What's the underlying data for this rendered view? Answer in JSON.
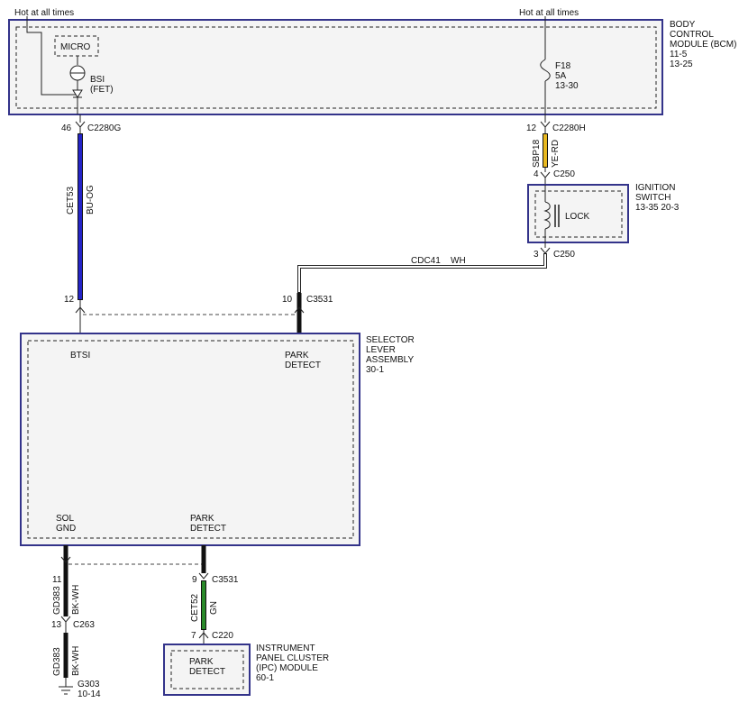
{
  "colors": {
    "bu_og": "#2424c8",
    "ye_rd": "#e8b820",
    "gn": "#2a8a2a",
    "bk_wh": "#222222",
    "wh": "#ffffff",
    "box_border": "#33338a"
  },
  "bcm": {
    "hot_left": "Hot at all times",
    "hot_right": "Hot at all times",
    "title_l1": "BODY",
    "title_l2": "CONTROL",
    "title_l3": "MODULE (BCM)",
    "ref1": "11-5",
    "ref2": "13-25",
    "micro": "MICRO",
    "bsi_l1": "BSI",
    "bsi_l2": "(FET)",
    "fuse_l1": "F18",
    "fuse_l2": "5A",
    "fuse_l3": "13-30"
  },
  "pins": {
    "p46": "46",
    "c2280g": "C2280G",
    "p12h": "12",
    "c2280h": "C2280H",
    "p4": "4",
    "c250a": "C250",
    "p3": "3",
    "c250b": "C250",
    "p12s": "12",
    "p10": "10",
    "c3531a": "C3531",
    "p11": "11",
    "p13": "13",
    "c263": "C263",
    "p9": "9",
    "c3531b": "C3531",
    "p7": "7",
    "c220": "C220",
    "g303": "G303",
    "g303_ref": "10-14"
  },
  "wires": {
    "cet53": "CET53",
    "bu_og": "BU-OG",
    "sbp18": "SBP18",
    "ye_rd": "YE-RD",
    "cdc41": "CDC41",
    "wh": "WH",
    "gd383a": "GD383",
    "bk_wh_a": "BK-WH",
    "gd383b": "GD383",
    "bk_wh_b": "BK-WH",
    "cet52": "CET52",
    "gn": "GN"
  },
  "ignition": {
    "title_l1": "IGNITION",
    "title_l2": "SWITCH",
    "refs": "13-35  20-3",
    "lock": "LOCK"
  },
  "selector": {
    "title_l1": "SELECTOR",
    "title_l2": "LEVER",
    "title_l3": "ASSEMBLY",
    "ref": "30-1",
    "btsi": "BTSI",
    "park_top_l1": "PARK",
    "park_top_l2": "DETECT",
    "sol_l1": "SOL",
    "sol_l2": "GND",
    "park_bot_l1": "PARK",
    "park_bot_l2": "DETECT"
  },
  "ipc": {
    "title_l1": "INSTRUMENT",
    "title_l2": "PANEL CLUSTER",
    "title_l3": "(IPC) MODULE",
    "ref": "60-1",
    "park_l1": "PARK",
    "park_l2": "DETECT"
  }
}
